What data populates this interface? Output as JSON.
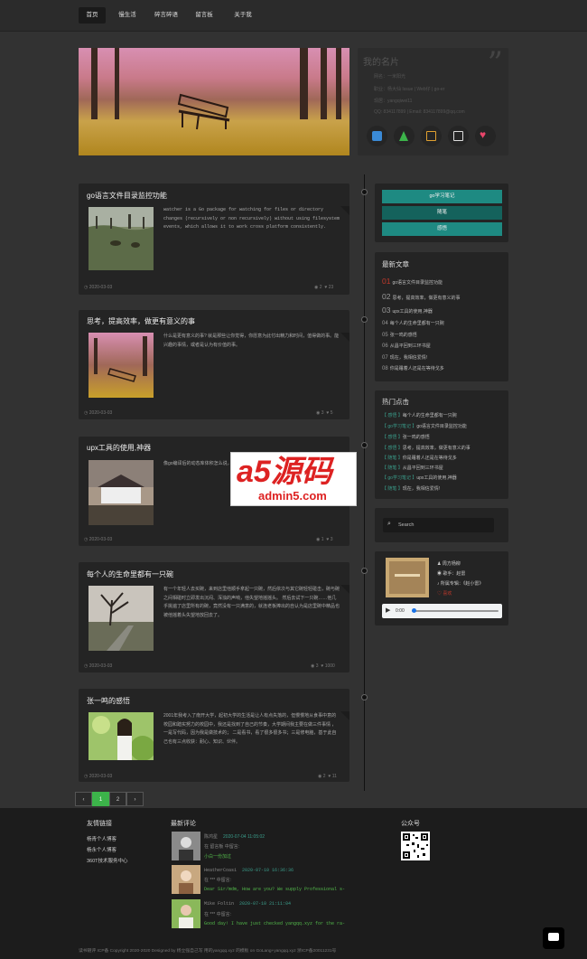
{
  "nav": {
    "items": [
      "首页",
      "慢生活",
      "碎言碎语",
      "留言板",
      "关于我"
    ],
    "active": 0
  },
  "profile": {
    "title": "我的名片",
    "lines": [
      "网名：一米阳光",
      "职业：杨大仙 Issue | Web仔 | go-er",
      "现居：yangqiwei11",
      "QQ: 834117899 | Email: 834117899@qq.com"
    ],
    "icons": [
      "chat-icon",
      "home-icon",
      "mail-icon",
      "image-icon",
      "heart-icon"
    ]
  },
  "posts": [
    {
      "title": "go语言文件目录监控功能",
      "excerpt": "watcher is a Go package for watching for files or directory changes (recursively or non recursively) without using filesystem events, which allows it to work cross platform consistently.",
      "date": "2020-03-03",
      "views": "2",
      "likes": "23"
    },
    {
      "title": "思考，提高效率，做更有意义的事",
      "excerpt": "什么是更有意义的事? 就是那些让你觉得，你愿意为此付出精力和时间，值得做的事。能兴趣的事情，或者是认为有价值的事。",
      "date": "2020-03-03",
      "views": "3",
      "likes": "5"
    },
    {
      "title": "upx工具的使用,神器",
      "excerpt": "像go编译后的动态库体积怎么说，问题... 解决这一问题。",
      "date": "2020-03-03",
      "views": "1",
      "likes": "3"
    },
    {
      "title": "每个人的生命里都有一只碗",
      "excerpt": "有一个年轻人去买碗，来到店里他顺手拿起一只碗，然后依次与其它碗轻轻碰击，碗与碗之间相碰时立即发出沉闷、浑浊的声响，他失望地摇摇头。 然后去试下一只碗……他几乎挑遍了店里所有的碗，竟然没有一只满意的，就连老板捧出的自认为是店里碗中精品也被他摇着头失望地放回去了。",
      "date": "2020-03-03",
      "views": "3",
      "likes": "1000"
    },
    {
      "title": "张一鸣的感悟",
      "excerpt": "2001年我考入了南开大学，起初大学的生活是让人有点失落的，但慢慢地从食事中意的校园和踏实努力的校园中，我还是找到了自己的节奏，大学期间我主要在做三件事情 ，一是写代码，因为我是做技术的； 二是看书，看了很多很多书；三是修电脑，基于此自己也有三点收获：耐心、知识、伙伴。",
      "date": "2020-03-03",
      "views": "2",
      "likes": "11"
    }
  ],
  "sidebar": {
    "buttons": [
      "go学习笔记",
      "随笔",
      "感悟"
    ],
    "latest_title": "最新文章",
    "latest": [
      {
        "n": "01",
        "t": "go语言文件目录监控功能"
      },
      {
        "n": "02",
        "t": "思考，提高效率，做更有意义的事"
      },
      {
        "n": "03",
        "t": "upx工具的使用,神器"
      },
      {
        "n": "04",
        "t": "每个人的生命里都有一只碗"
      },
      {
        "n": "05",
        "t": "张一鸣的感悟"
      },
      {
        "n": "06",
        "t": "从昌平回到三环书屋"
      },
      {
        "n": "07",
        "t": "现在，我相信爱情!"
      },
      {
        "n": "08",
        "t": "你是睡着人还是在等待戈多"
      }
    ],
    "hot_title": "热门点击",
    "hot": [
      {
        "tag": "【 感悟 】",
        "t": "每个人的生命里都有一只碗"
      },
      {
        "tag": "【 go学习笔记 】",
        "t": "go语言文件目录监控功能"
      },
      {
        "tag": "【 感悟 】",
        "t": "张一鸣的感悟"
      },
      {
        "tag": "【 感悟 】",
        "t": "思考，提高效率，做更有意义的事"
      },
      {
        "tag": "【 随笔 】",
        "t": "你是睡着人还是在等待戈多"
      },
      {
        "tag": "【 随笔 】",
        "t": "从昌平回到三环书屋"
      },
      {
        "tag": "【 go学习笔记 】",
        "t": "upx工具的使用,神器"
      },
      {
        "tag": "【 随笔 】",
        "t": "现在，我相信爱情!"
      }
    ],
    "search_placeholder": "Search",
    "music": {
      "artist": "周方杨柳",
      "singer": "歌手：赵雷",
      "album": "所属专辑：《赵小雷》",
      "like": "喜欢",
      "time": "0:00"
    }
  },
  "pagination": {
    "prev": "‹",
    "pages": [
      "1",
      "2"
    ],
    "next": "›"
  },
  "watermark": {
    "big": "a5源码",
    "url": "admin5.com"
  },
  "footer": {
    "links_title": "友情链接",
    "links": [
      "杨青个人博客",
      "杨永个人博客",
      "360T技术服务中心"
    ],
    "comments_title": "最新评论",
    "comments": [
      {
        "name": "陈鸿星",
        "date": "2020-07-04 11:05:02",
        "on": "在 留言板 中留言:",
        "text": "小白一份加过"
      },
      {
        "name": "HeatherCoasi",
        "date": "2020-07-10 16:36:36",
        "on": "在 *** 中留言:",
        "text": "Dear Sir/mdm, How are you? We supply Professional s-"
      },
      {
        "name": "Mike Foltin",
        "date": "2020-07-10 21:11:04",
        "on": "在 *** 中留言:",
        "text": "Good day! I have just checked yangqq.xyz for the ra-"
      }
    ],
    "wechat_title": "公众号",
    "copyright": "读书随评 ICP备 Copyright 2020-2020 Designed by 杨立强自己写 用的yangqq.xyz 的模板 on GoLang+yangqq.xyz 浙ICP备20011231号"
  },
  "colors": {
    "accent": "#1e8a82",
    "red": "#c0392b",
    "green": "#52b74a"
  }
}
